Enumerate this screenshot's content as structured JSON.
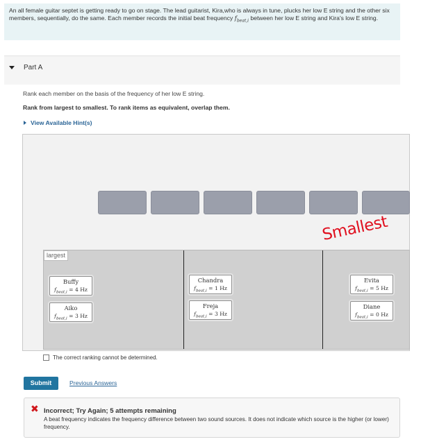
{
  "intro": {
    "text_a": "An all female guitar septet is getting ready to go on stage. The lead guitarist, Kira,who is always in tune, plucks her low E string and the other six members, sequentially, do the same. Each member records the initial beat frequency ",
    "f": "f",
    "f_sub": "beat,i",
    "text_b": " between her low E string and Kira's low E string."
  },
  "part": {
    "label": "Part A"
  },
  "instructions": {
    "line1": "Rank each member on the basis of the frequency of her low E string.",
    "line2": "Rank from largest to smallest. To rank items as equivalent, overlap them."
  },
  "hint": {
    "label": "View Available Hint(s)"
  },
  "ranking": {
    "largest_label": "largest",
    "smallest_annotation": "Smallest",
    "freq_symbol": "f",
    "freq_sub": "beat,i",
    "items": [
      {
        "name": "Buffy",
        "value": "= 4 Hz"
      },
      {
        "name": "Aiko",
        "value": "= 3 Hz"
      },
      {
        "name": "Chandra",
        "value": "= 1 Hz"
      },
      {
        "name": "Freja",
        "value": "= 3 Hz"
      },
      {
        "name": "Evita",
        "value": "= 5 Hz"
      },
      {
        "name": "Diane",
        "value": "= 0 Hz"
      }
    ],
    "cannot_determine": "The correct ranking cannot be determined."
  },
  "actions": {
    "submit": "Submit",
    "previous_answers": "Previous Answers"
  },
  "feedback": {
    "title": "Incorrect; Try Again; 5 attempts remaining",
    "message": "A beat frequency indicates the frequency difference between two sound sources. It does not indicate which source is the higher (or lower) frequency."
  },
  "colors": {
    "accent": "#2175a0",
    "link": "#2a6496",
    "error": "#d0161b",
    "annotation": "#e0101f",
    "slot": "#9b9fab",
    "bin": "#d0d0d0"
  }
}
